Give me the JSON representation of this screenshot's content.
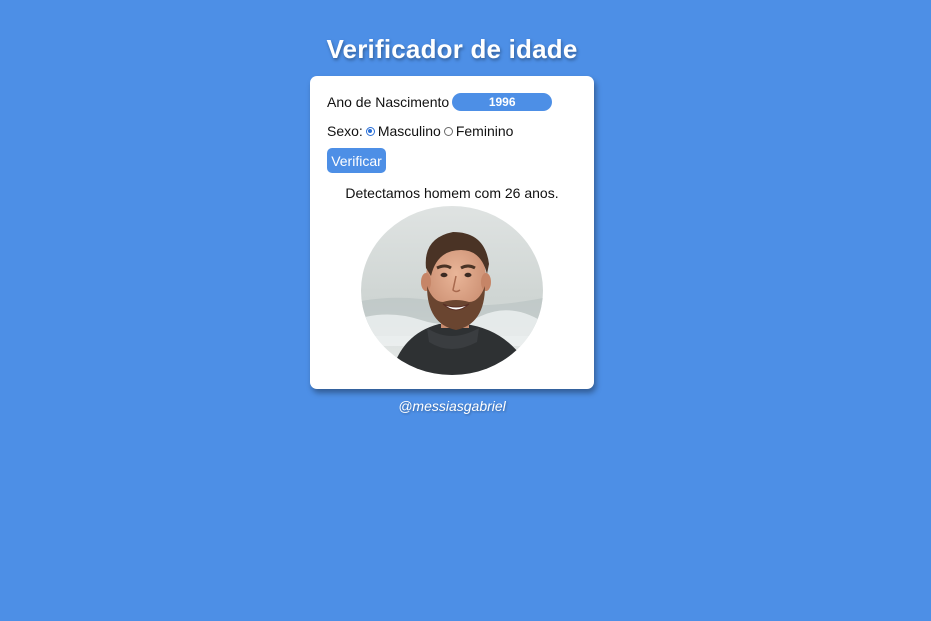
{
  "page": {
    "title": "Verificador de idade",
    "credit": "@messiasgabriel"
  },
  "form": {
    "birth_year_label": "Ano de Nascimento",
    "birth_year_value": "1996",
    "sex_label": "Sexo:",
    "sex_options": [
      "Masculino",
      "Feminino"
    ],
    "sex_selected": "Masculino",
    "verify_label": "Verificar"
  },
  "result": {
    "message": "Detectamos homem com 26 anos.",
    "photo_icon": "bearded-man-photo"
  },
  "colors": {
    "background": "#4d8fe6",
    "card": "#ffffff",
    "accent": "#4d8fe6"
  }
}
